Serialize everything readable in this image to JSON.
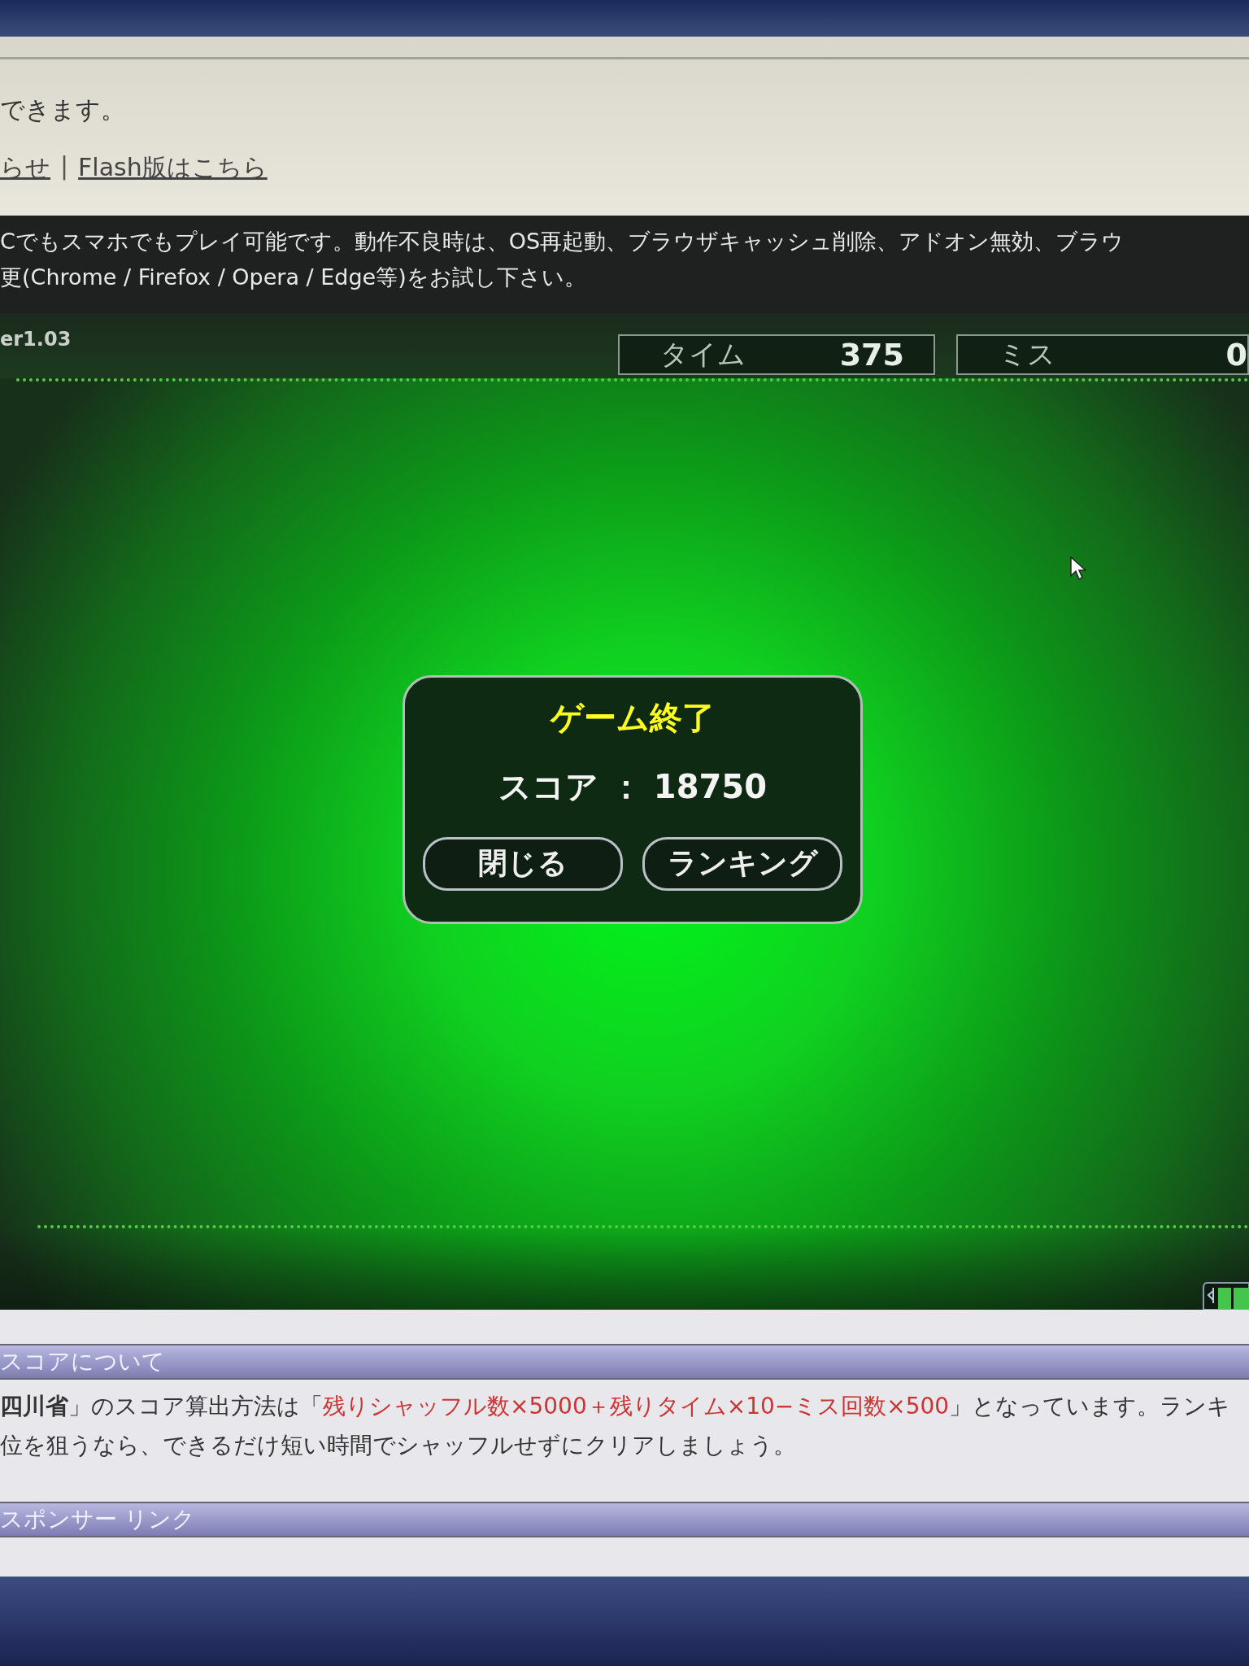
{
  "top_panel": {
    "notice": "できます。",
    "links": [
      {
        "text": "らせ"
      },
      {
        "text": "Flash版はこちら"
      }
    ],
    "separator": "|"
  },
  "info_band": {
    "lines": [
      "Cでもスマホでもプレイ可能です。動作不良時は、OS再起動、ブラウザキャッシュ削除、アドオン無効、ブラウ",
      "更(Chrome / Firefox / Opera / Edge等)をお試し下さい。"
    ]
  },
  "game": {
    "version": "er1.03",
    "stats": [
      {
        "label": "タイム",
        "value": "375"
      },
      {
        "label": "ミス",
        "value": "0"
      }
    ],
    "dialog": {
      "title": "ゲーム終了",
      "score_label": "スコア",
      "score_separator": "：",
      "score": "18750",
      "buttons": [
        "閉じる",
        "ランキング"
      ]
    }
  },
  "score_section": {
    "heading": "スコアについて",
    "lines": [
      [
        {
          "kind": "bold",
          "text": "四川省"
        },
        {
          "kind": "plain",
          "text": "」のスコア算出方法は「"
        },
        {
          "kind": "red",
          "text": "残りシャッフル数×5000＋残りタイム×10−ミス回数×500"
        },
        {
          "kind": "plain",
          "text": "」となっています。ランキ"
        }
      ],
      [
        {
          "kind": "plain",
          "text": "位を狙うなら、できるだけ短い時間でシャッフルせずにクリアしましょう。"
        }
      ]
    ]
  },
  "sponsor_section": {
    "heading": "スポンサー リンク"
  }
}
